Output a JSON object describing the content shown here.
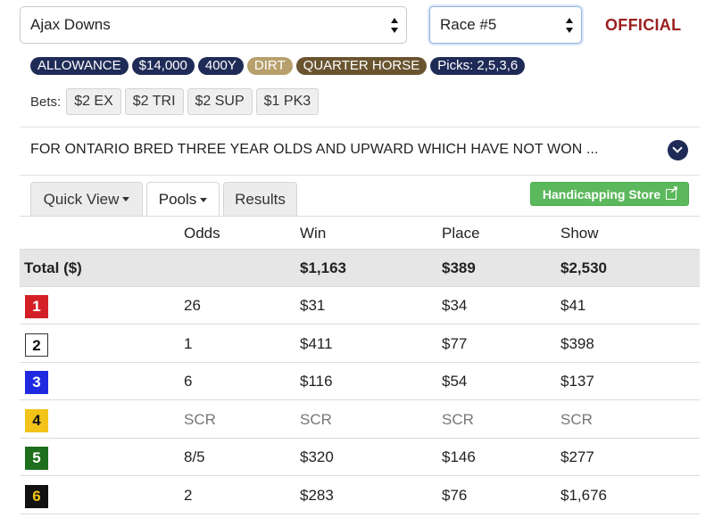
{
  "track_select": {
    "value": "Ajax Downs"
  },
  "race_select": {
    "value": "Race #5"
  },
  "status": "OFFICIAL",
  "badges": [
    "ALLOWANCE",
    "$14,000",
    "400Y",
    "DIRT",
    "QUARTER HORSE",
    "Picks: 2,5,3,6"
  ],
  "bets": {
    "label": "Bets:",
    "items": [
      "$2 EX",
      "$2 TRI",
      "$2 SUP",
      "$1 PK3"
    ]
  },
  "condition_text": "FOR ONTARIO BRED THREE YEAR OLDS AND UPWARD WHICH HAVE NOT WON ...",
  "tabs": [
    "Quick View",
    "Pools",
    "Results"
  ],
  "store_button": "Handicapping Store",
  "table": {
    "headers": {
      "odds": "Odds",
      "win": "Win",
      "place": "Place",
      "show": "Show"
    },
    "total": {
      "label": "Total ($)",
      "win": "$1,163",
      "place": "$389",
      "show": "$2,530"
    },
    "rows": [
      {
        "pp": "1",
        "bg": "#d32027",
        "fg": "#ffffff",
        "odds": "26",
        "win": "$31",
        "place": "$34",
        "show": "$41"
      },
      {
        "pp": "2",
        "bg": "#ffffff",
        "fg": "#111111",
        "odds": "1",
        "win": "$411",
        "place": "$77",
        "show": "$398"
      },
      {
        "pp": "3",
        "bg": "#1f2ae0",
        "fg": "#ffffff",
        "odds": "6",
        "win": "$116",
        "place": "$54",
        "show": "$137"
      },
      {
        "pp": "4",
        "bg": "#f2c318",
        "fg": "#111111",
        "odds": "SCR",
        "win": "SCR",
        "place": "SCR",
        "show": "SCR"
      },
      {
        "pp": "5",
        "bg": "#1d6e1d",
        "fg": "#ffffff",
        "odds": "8/5",
        "win": "$320",
        "place": "$146",
        "show": "$277"
      },
      {
        "pp": "6",
        "bg": "#111111",
        "fg": "#f2c318",
        "odds": "2",
        "win": "$283",
        "place": "$76",
        "show": "$1,676"
      }
    ]
  }
}
